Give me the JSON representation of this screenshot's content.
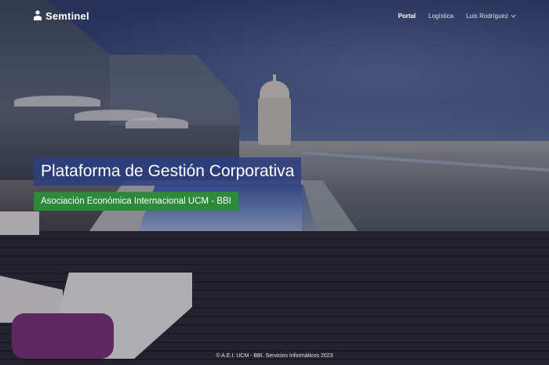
{
  "brand": {
    "name": "Semtinel",
    "icon": "person-icon"
  },
  "nav": {
    "items": [
      {
        "label": "Portal",
        "active": true
      },
      {
        "label": "Logística",
        "active": false
      }
    ],
    "user": {
      "label": "Luis Rodríguez",
      "icon": "chevron-down-icon"
    }
  },
  "hero": {
    "title": "Plataforma de Gestión Corporativa",
    "subtitle": "Asociación Económica Internacional UCM - BBI"
  },
  "footer": {
    "text": "© A.E.I. UCM - BBI. Servicios Informáticos 2023"
  },
  "colors": {
    "title_bg": "#2d3f80",
    "subtitle_bg": "#2c8a3b",
    "text": "#ffffff"
  }
}
